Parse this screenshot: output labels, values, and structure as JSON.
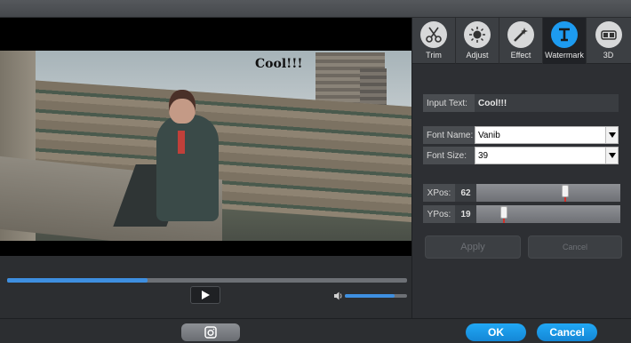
{
  "preview": {
    "watermark_text": "Cool!!!",
    "progress_fraction": 0.35,
    "volume_fraction": 0.8
  },
  "tabs": [
    {
      "label": "Trim",
      "icon": "scissors-icon"
    },
    {
      "label": "Adjust",
      "icon": "brightness-icon"
    },
    {
      "label": "Effect",
      "icon": "magic-wand-icon"
    },
    {
      "label": "Watermark",
      "icon": "text-icon",
      "active": true
    },
    {
      "label": "3D",
      "icon": "3d-glasses-icon"
    }
  ],
  "watermark": {
    "input_text_label": "Input Text:",
    "input_text_value": "Cool!!!",
    "font_name_label": "Font Name:",
    "font_name_value": "Vanib",
    "font_size_label": "Font Size:",
    "font_size_value": "39",
    "xpos_label": "XPos:",
    "xpos_value": "62",
    "ypos_label": "YPos:",
    "ypos_value": "19",
    "xpos_fraction": 0.62,
    "ypos_fraction": 0.19,
    "apply_label": "Apply",
    "cancel_label": "Cancel"
  },
  "footer": {
    "ok_label": "OK",
    "cancel_label": "Cancel"
  },
  "colors": {
    "accent": "#1d9bf0",
    "progress": "#3e8fe0",
    "slider_mark": "#d0322c"
  }
}
